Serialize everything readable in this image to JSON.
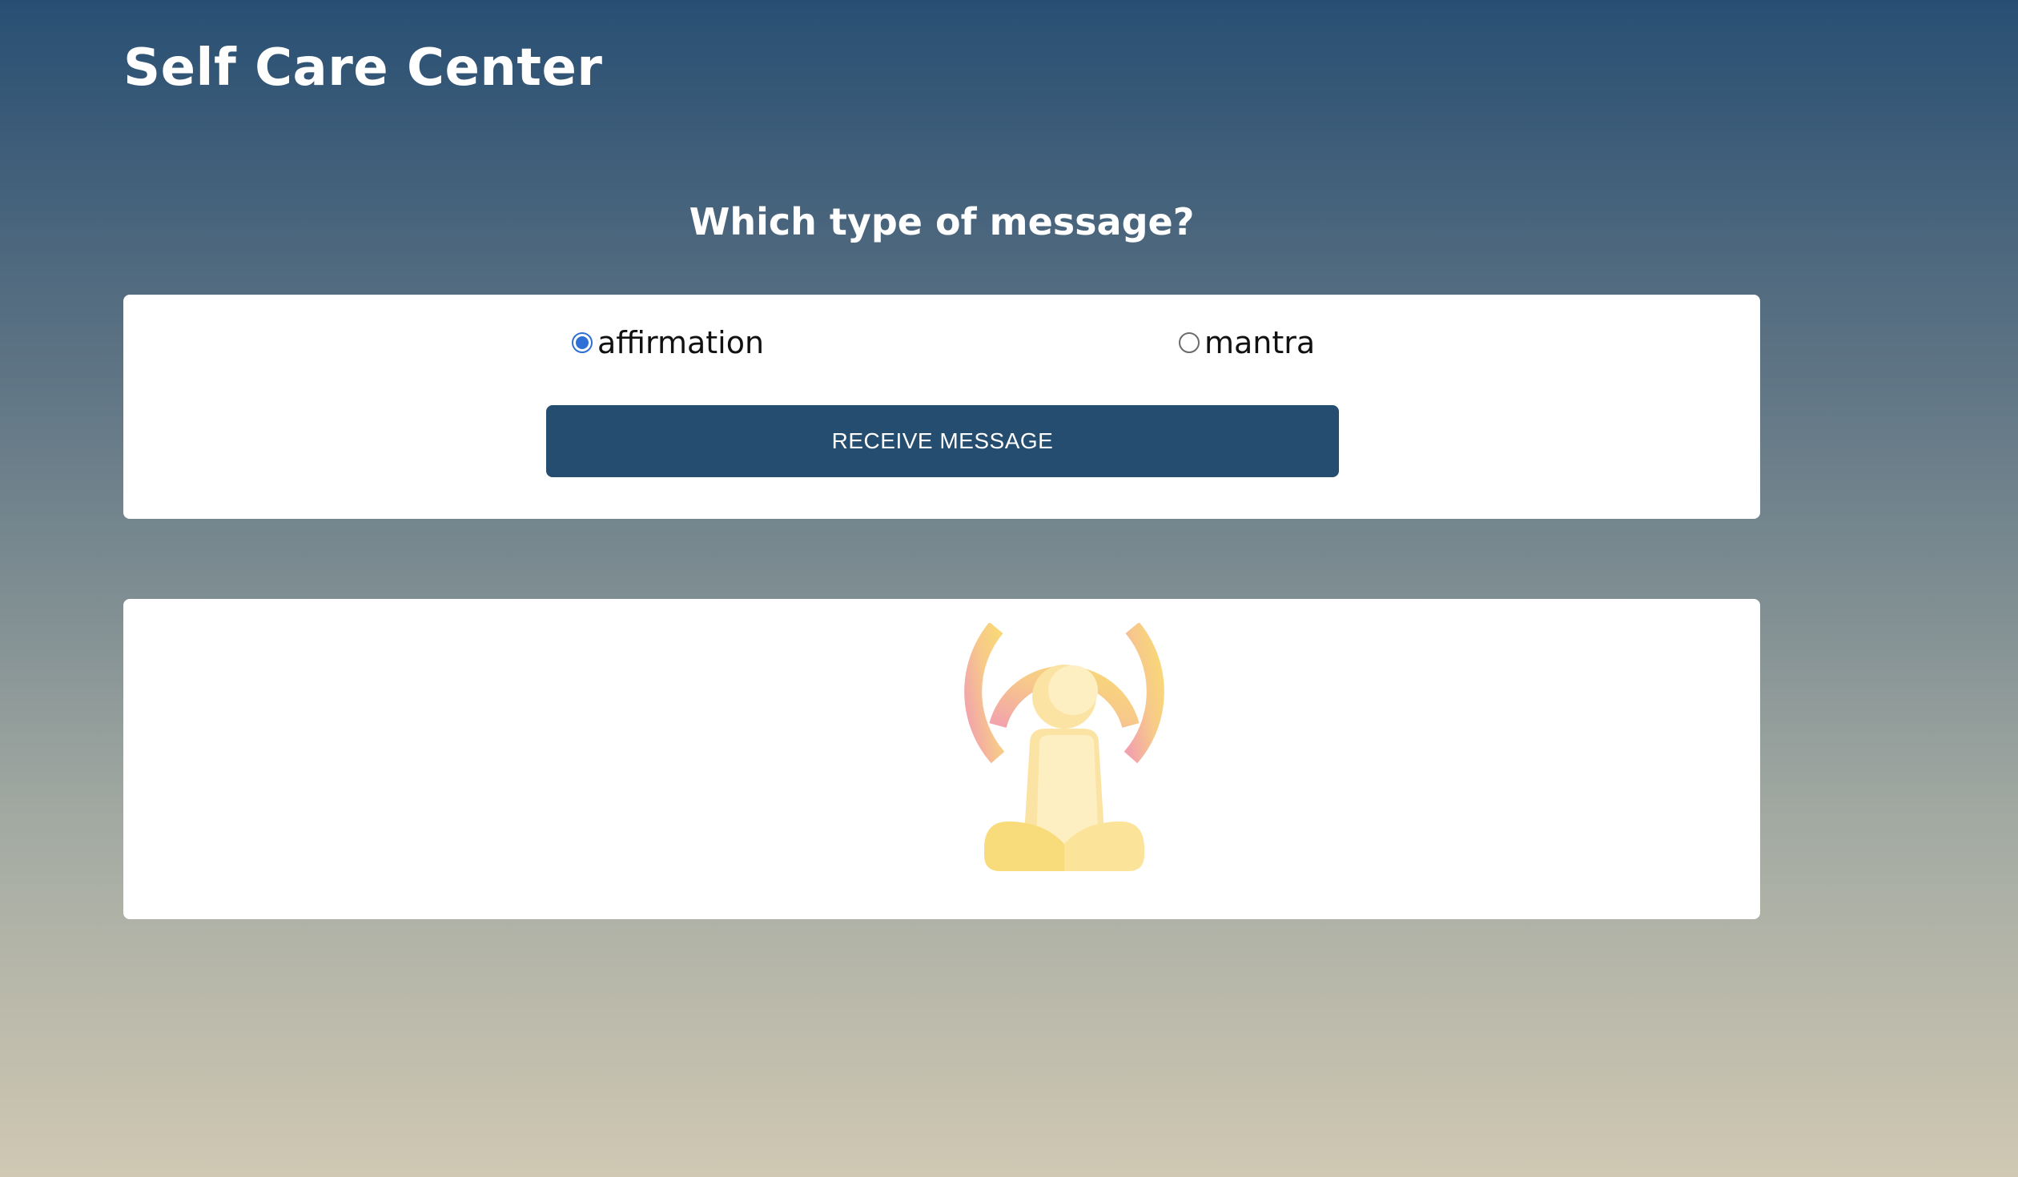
{
  "header": {
    "title": "Self Care Center"
  },
  "prompt": {
    "question": "Which type of message?"
  },
  "options": [
    {
      "label": "affirmation",
      "checked": true
    },
    {
      "label": "mantra",
      "checked": false
    }
  ],
  "actions": {
    "receive_label": "RECEIVE MESSAGE"
  },
  "output": {
    "icon": "meditation-icon"
  },
  "colors": {
    "button_bg": "#244d6f",
    "radio_accent": "#2f6fd6",
    "gradient_top": "#284f73",
    "gradient_bottom": "#d0c8b3"
  }
}
